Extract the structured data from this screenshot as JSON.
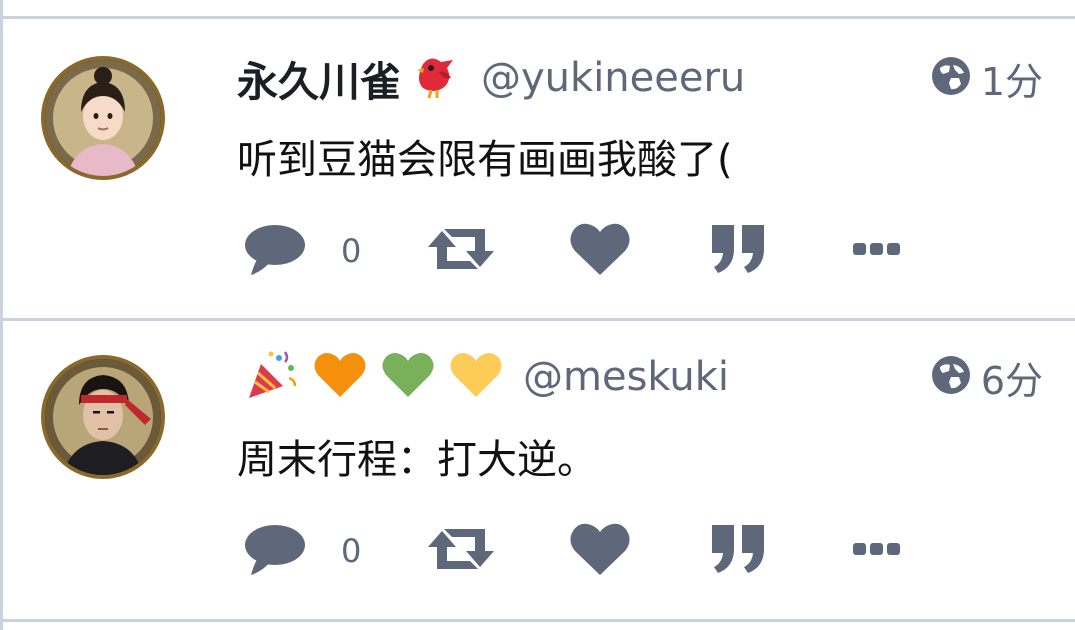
{
  "posts": [
    {
      "display_name": "永久川雀",
      "name_emoji": [
        "bird-emoji"
      ],
      "handle": "@yukineeeru",
      "time": "1分",
      "content": "听到豆猫会限有画画我酸了(",
      "reply_count": "0"
    },
    {
      "display_name": "",
      "name_emoji": [
        "party-popper-emoji",
        "orange-heart-emoji",
        "green-heart-emoji",
        "yellow-heart-emoji"
      ],
      "handle": "@meskuki",
      "time": "6分",
      "content": "周末行程：打大逆。",
      "reply_count": "0"
    }
  ],
  "colors": {
    "icon": "#5e687a",
    "separator": "#c9d3df",
    "text": "#111111"
  },
  "icons": [
    "globe-icon",
    "reply-icon",
    "boost-icon",
    "favourite-icon",
    "quote-icon",
    "more-icon"
  ]
}
